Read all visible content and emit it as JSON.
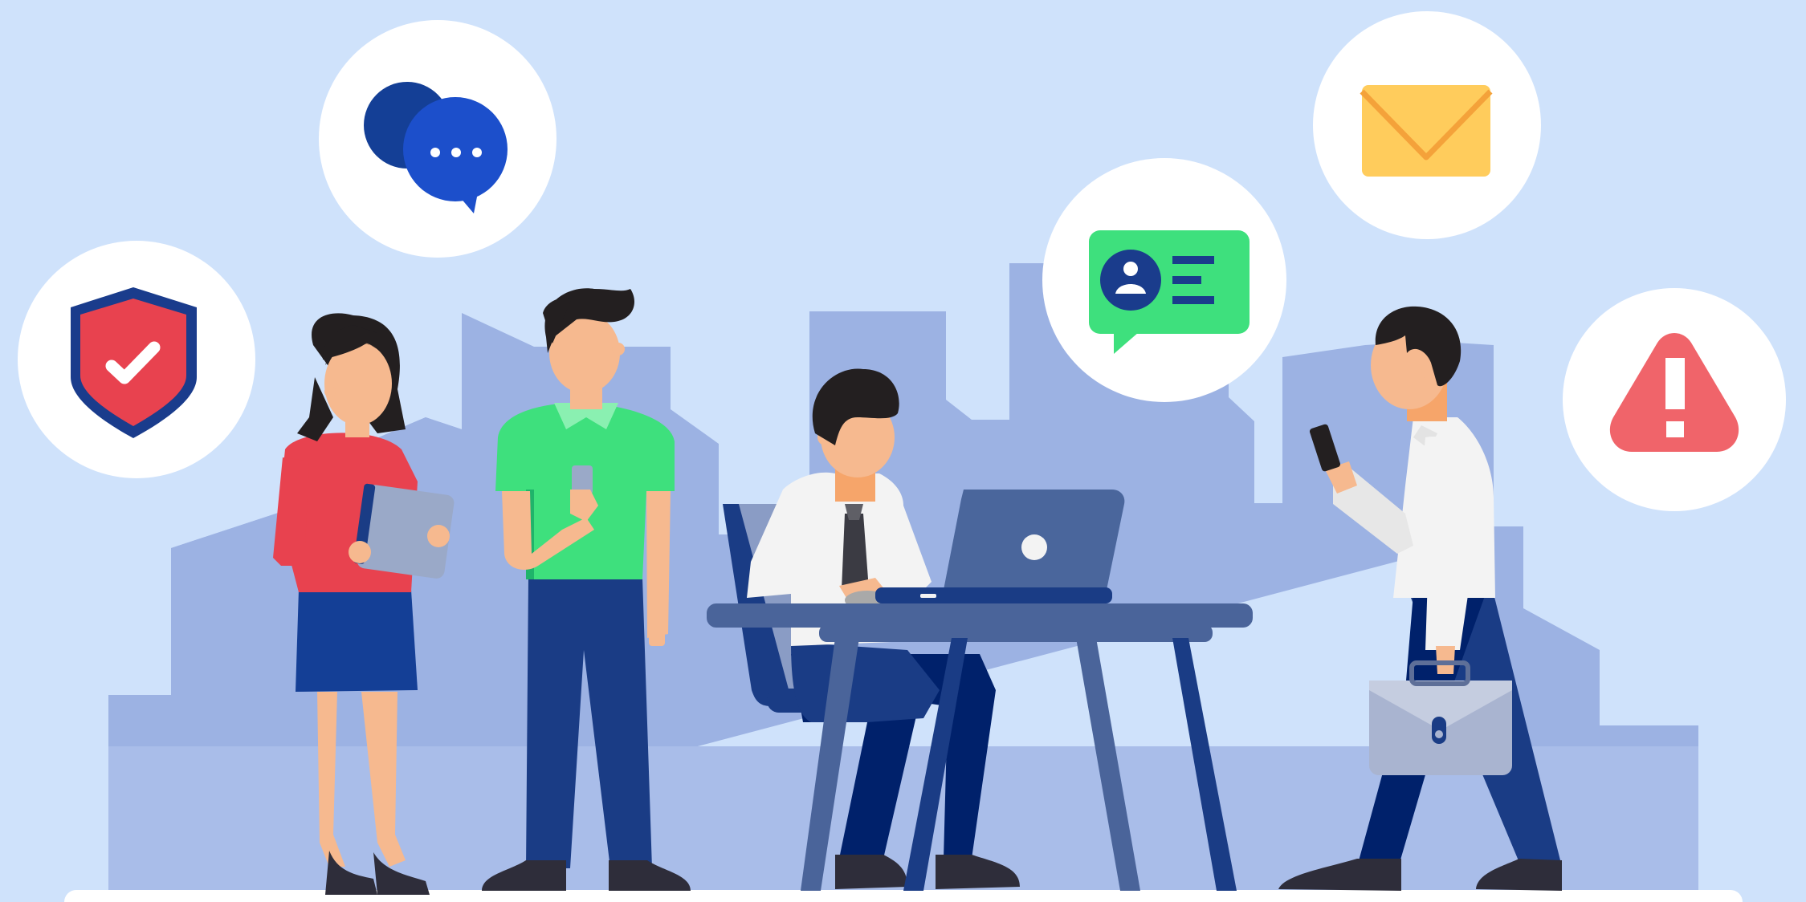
{
  "scene": {
    "kind": "flat-illustration",
    "icons": [
      "shield-check-icon",
      "chat-bubbles-icon",
      "id-card-icon",
      "envelope-icon",
      "warning-icon"
    ],
    "people": [
      "woman-with-tablet",
      "man-with-phone",
      "man-at-laptop",
      "man-walking-with-briefcase"
    ]
  },
  "colors": {
    "background": "#cfe2fb",
    "skyline": "#9cb2e3",
    "skyline_light": "#a9bde9",
    "circle": "#ffffff",
    "shield_red": "#e8424f",
    "shield_border": "#1a3c8c",
    "chat_dark": "#143f96",
    "chat_light": "#1c4fcb",
    "card_green": "#3ee07d",
    "card_navy": "#1a3c8c",
    "envelope": "#ffcc5c",
    "envelope_line": "#f4a23a",
    "warning_red": "#f0646a",
    "desk": "#4a649a",
    "laptop": "#4a669c",
    "navy_pants": "#1a3c85",
    "dark_navy": "#00216b",
    "skin": "#f6b98f",
    "hair": "#231f20",
    "shoes": "#2e2d3a",
    "red_shirt": "#e8424f",
    "green_shirt": "#3ee07d",
    "white_shirt": "#f3f3f3",
    "tablet": "#9aa9c8",
    "briefcase": "#a9b4d0",
    "floor": "#ffffff"
  }
}
